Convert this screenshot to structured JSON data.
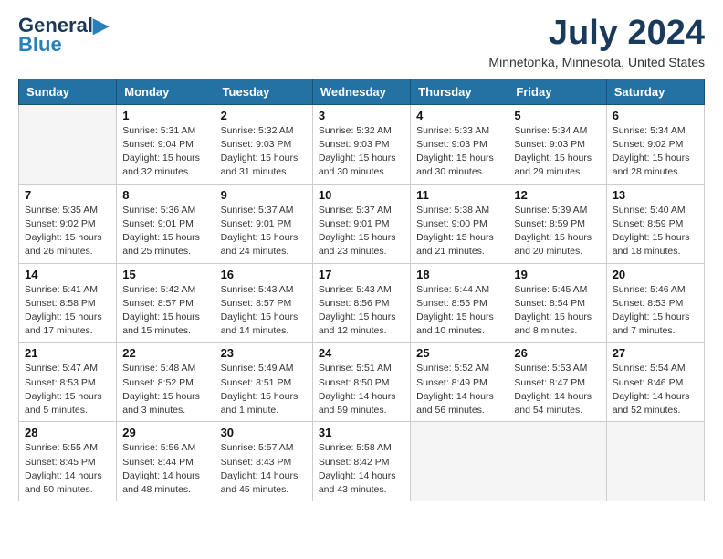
{
  "logo": {
    "line1": "General",
    "line2": "Blue"
  },
  "title": "July 2024",
  "location": "Minnetonka, Minnesota, United States",
  "days_of_week": [
    "Sunday",
    "Monday",
    "Tuesday",
    "Wednesday",
    "Thursday",
    "Friday",
    "Saturday"
  ],
  "weeks": [
    [
      {
        "num": "",
        "empty": true
      },
      {
        "num": "1",
        "sunrise": "Sunrise: 5:31 AM",
        "sunset": "Sunset: 9:04 PM",
        "daylight": "Daylight: 15 hours and 32 minutes."
      },
      {
        "num": "2",
        "sunrise": "Sunrise: 5:32 AM",
        "sunset": "Sunset: 9:03 PM",
        "daylight": "Daylight: 15 hours and 31 minutes."
      },
      {
        "num": "3",
        "sunrise": "Sunrise: 5:32 AM",
        "sunset": "Sunset: 9:03 PM",
        "daylight": "Daylight: 15 hours and 30 minutes."
      },
      {
        "num": "4",
        "sunrise": "Sunrise: 5:33 AM",
        "sunset": "Sunset: 9:03 PM",
        "daylight": "Daylight: 15 hours and 30 minutes."
      },
      {
        "num": "5",
        "sunrise": "Sunrise: 5:34 AM",
        "sunset": "Sunset: 9:03 PM",
        "daylight": "Daylight: 15 hours and 29 minutes."
      },
      {
        "num": "6",
        "sunrise": "Sunrise: 5:34 AM",
        "sunset": "Sunset: 9:02 PM",
        "daylight": "Daylight: 15 hours and 28 minutes."
      }
    ],
    [
      {
        "num": "7",
        "sunrise": "Sunrise: 5:35 AM",
        "sunset": "Sunset: 9:02 PM",
        "daylight": "Daylight: 15 hours and 26 minutes."
      },
      {
        "num": "8",
        "sunrise": "Sunrise: 5:36 AM",
        "sunset": "Sunset: 9:01 PM",
        "daylight": "Daylight: 15 hours and 25 minutes."
      },
      {
        "num": "9",
        "sunrise": "Sunrise: 5:37 AM",
        "sunset": "Sunset: 9:01 PM",
        "daylight": "Daylight: 15 hours and 24 minutes."
      },
      {
        "num": "10",
        "sunrise": "Sunrise: 5:37 AM",
        "sunset": "Sunset: 9:01 PM",
        "daylight": "Daylight: 15 hours and 23 minutes."
      },
      {
        "num": "11",
        "sunrise": "Sunrise: 5:38 AM",
        "sunset": "Sunset: 9:00 PM",
        "daylight": "Daylight: 15 hours and 21 minutes."
      },
      {
        "num": "12",
        "sunrise": "Sunrise: 5:39 AM",
        "sunset": "Sunset: 8:59 PM",
        "daylight": "Daylight: 15 hours and 20 minutes."
      },
      {
        "num": "13",
        "sunrise": "Sunrise: 5:40 AM",
        "sunset": "Sunset: 8:59 PM",
        "daylight": "Daylight: 15 hours and 18 minutes."
      }
    ],
    [
      {
        "num": "14",
        "sunrise": "Sunrise: 5:41 AM",
        "sunset": "Sunset: 8:58 PM",
        "daylight": "Daylight: 15 hours and 17 minutes."
      },
      {
        "num": "15",
        "sunrise": "Sunrise: 5:42 AM",
        "sunset": "Sunset: 8:57 PM",
        "daylight": "Daylight: 15 hours and 15 minutes."
      },
      {
        "num": "16",
        "sunrise": "Sunrise: 5:43 AM",
        "sunset": "Sunset: 8:57 PM",
        "daylight": "Daylight: 15 hours and 14 minutes."
      },
      {
        "num": "17",
        "sunrise": "Sunrise: 5:43 AM",
        "sunset": "Sunset: 8:56 PM",
        "daylight": "Daylight: 15 hours and 12 minutes."
      },
      {
        "num": "18",
        "sunrise": "Sunrise: 5:44 AM",
        "sunset": "Sunset: 8:55 PM",
        "daylight": "Daylight: 15 hours and 10 minutes."
      },
      {
        "num": "19",
        "sunrise": "Sunrise: 5:45 AM",
        "sunset": "Sunset: 8:54 PM",
        "daylight": "Daylight: 15 hours and 8 minutes."
      },
      {
        "num": "20",
        "sunrise": "Sunrise: 5:46 AM",
        "sunset": "Sunset: 8:53 PM",
        "daylight": "Daylight: 15 hours and 7 minutes."
      }
    ],
    [
      {
        "num": "21",
        "sunrise": "Sunrise: 5:47 AM",
        "sunset": "Sunset: 8:53 PM",
        "daylight": "Daylight: 15 hours and 5 minutes."
      },
      {
        "num": "22",
        "sunrise": "Sunrise: 5:48 AM",
        "sunset": "Sunset: 8:52 PM",
        "daylight": "Daylight: 15 hours and 3 minutes."
      },
      {
        "num": "23",
        "sunrise": "Sunrise: 5:49 AM",
        "sunset": "Sunset: 8:51 PM",
        "daylight": "Daylight: 15 hours and 1 minute."
      },
      {
        "num": "24",
        "sunrise": "Sunrise: 5:51 AM",
        "sunset": "Sunset: 8:50 PM",
        "daylight": "Daylight: 14 hours and 59 minutes."
      },
      {
        "num": "25",
        "sunrise": "Sunrise: 5:52 AM",
        "sunset": "Sunset: 8:49 PM",
        "daylight": "Daylight: 14 hours and 56 minutes."
      },
      {
        "num": "26",
        "sunrise": "Sunrise: 5:53 AM",
        "sunset": "Sunset: 8:47 PM",
        "daylight": "Daylight: 14 hours and 54 minutes."
      },
      {
        "num": "27",
        "sunrise": "Sunrise: 5:54 AM",
        "sunset": "Sunset: 8:46 PM",
        "daylight": "Daylight: 14 hours and 52 minutes."
      }
    ],
    [
      {
        "num": "28",
        "sunrise": "Sunrise: 5:55 AM",
        "sunset": "Sunset: 8:45 PM",
        "daylight": "Daylight: 14 hours and 50 minutes."
      },
      {
        "num": "29",
        "sunrise": "Sunrise: 5:56 AM",
        "sunset": "Sunset: 8:44 PM",
        "daylight": "Daylight: 14 hours and 48 minutes."
      },
      {
        "num": "30",
        "sunrise": "Sunrise: 5:57 AM",
        "sunset": "Sunset: 8:43 PM",
        "daylight": "Daylight: 14 hours and 45 minutes."
      },
      {
        "num": "31",
        "sunrise": "Sunrise: 5:58 AM",
        "sunset": "Sunset: 8:42 PM",
        "daylight": "Daylight: 14 hours and 43 minutes."
      },
      {
        "num": "",
        "empty": true
      },
      {
        "num": "",
        "empty": true
      },
      {
        "num": "",
        "empty": true
      }
    ]
  ]
}
